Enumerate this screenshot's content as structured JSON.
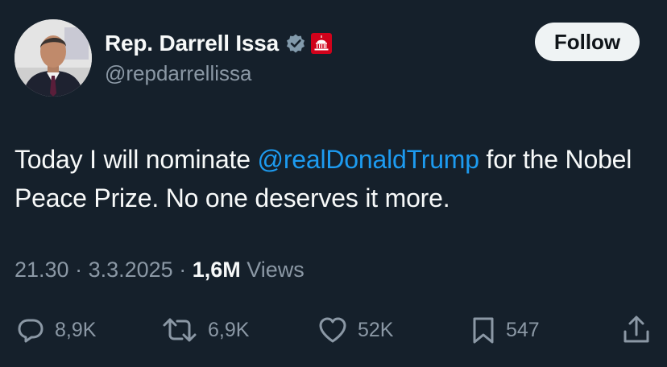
{
  "author": {
    "display_name": "Rep. Darrell Issa",
    "handle": "@repdarrellissa",
    "verified": true,
    "badge": "government-capitol-badge"
  },
  "header": {
    "follow_label": "Follow"
  },
  "tweet": {
    "text_before": "Today I will nominate ",
    "mention": "@realDonaldTrump",
    "text_after": " for the Nobel Peace Prize. No one deserves it more."
  },
  "meta": {
    "time": "21.30",
    "separator": " · ",
    "date": "3.3.2025",
    "views_count": "1,6M",
    "views_label": " Views"
  },
  "actions": {
    "replies": "8,9K",
    "reposts": "6,9K",
    "likes": "52K",
    "bookmarks": "547"
  },
  "colors": {
    "background": "#15202b",
    "text": "#f7f9f9",
    "secondary": "#8b98a5",
    "link": "#1d9bf0",
    "follow_bg": "#eff3f4",
    "badge_red": "#d0021b"
  },
  "icons": [
    "verified-icon",
    "capitol-badge-icon",
    "reply-icon",
    "repost-icon",
    "like-icon",
    "bookmark-icon",
    "share-icon"
  ]
}
